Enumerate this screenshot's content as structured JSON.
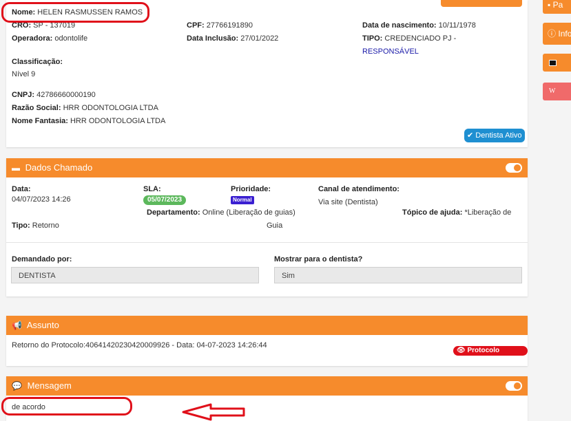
{
  "dentist": {
    "nome_label": "Nome:",
    "nome_value": "HELEN RASMUSSEN RAMOS",
    "cro_label": "CRO:",
    "cro_value": "SP - 137019",
    "cpf_label": "CPF:",
    "cpf_value": "27766191890",
    "nasc_label": "Data de nascimento:",
    "nasc_value": "10/11/1978",
    "operadora_label": "Operadora:",
    "operadora_value": "odontolife",
    "inclusao_label": "Data Inclusão:",
    "inclusao_value": "27/01/2022",
    "tipo_label": "TIPO:",
    "tipo_value": "CREDENCIADO PJ -",
    "tipo_value2": "RESPONSÁVEL",
    "classificacao_label": "Classificação:",
    "classificacao_value": "Nível 9",
    "cnpj_label": "CNPJ:",
    "cnpj_value": "42786660000190",
    "razao_label": "Razão Social:",
    "razao_value": "HRR ODONTOLOGIA LTDA",
    "fantasia_label": "Nome Fantasia:",
    "fantasia_value": "HRR ODONTOLOGIA LTDA",
    "status_badge": "Dentista Ativo"
  },
  "chamado": {
    "title": "Dados Chamado",
    "data_label": "Data:",
    "data_value": "04/07/2023 14:26",
    "sla_label": "SLA:",
    "sla_value": "05/07/2023",
    "prioridade_label": "Prioridade:",
    "prioridade_value": "Normal",
    "canal_label": "Canal de atendimento:",
    "canal_value": "Via site (Dentista)",
    "departamento_label": "Departamento:",
    "departamento_value": "Online (Liberação de guias)",
    "topico_label": "Tópico de ajuda:",
    "topico_value": "*Liberação de",
    "topico_value2": "Guia",
    "tipo_label": "Tipo:",
    "tipo_value": "Retorno",
    "demandado_label": "Demandado por:",
    "demandado_value": "DENTISTA",
    "mostrar_label": "Mostrar para o dentista?",
    "mostrar_value": "Sim"
  },
  "assunto": {
    "title": "Assunto",
    "text": "Retorno do Protocolo:40641420230420009926 - Data: 04-07-2023 14:26:44",
    "protocolo_button": "Protocolo original"
  },
  "mensagem": {
    "title": "Mensagem",
    "text": "de acordo"
  },
  "sidebar": {
    "btn1": "Pa",
    "btn2": "Info",
    "btn4": "W"
  },
  "colors": {
    "accent": "#f68b2c",
    "active_badge": "#1e8fd1",
    "sla_badge": "#5cb85c",
    "priority_badge": "#3a1fd1",
    "danger": "#e0101a"
  }
}
